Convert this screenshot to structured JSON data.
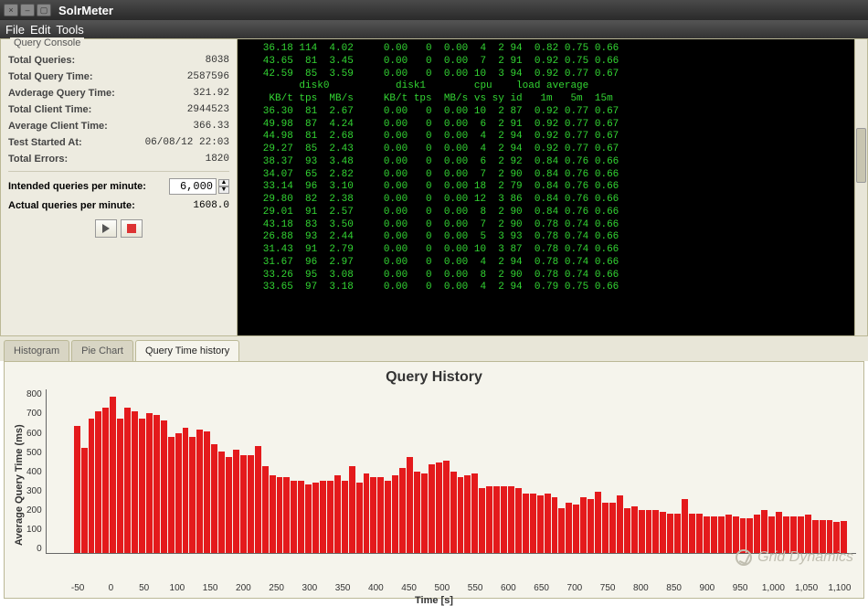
{
  "window": {
    "title": "SolrMeter"
  },
  "menu": {
    "file": "File",
    "edit": "Edit",
    "tools": "Tools"
  },
  "panel": {
    "legend": "Query Console",
    "stats": [
      {
        "label": "Total Queries:",
        "value": "8038"
      },
      {
        "label": "Total Query Time:",
        "value": "2587596"
      },
      {
        "label": "Avderage Query Time:",
        "value": "321.92"
      },
      {
        "label": "Total Client Time:",
        "value": "2944523"
      },
      {
        "label": "Average Client Time:",
        "value": "366.33"
      },
      {
        "label": "Test Started At:",
        "value": "06/08/12 22:03"
      },
      {
        "label": "Total Errors:",
        "value": "1820"
      }
    ],
    "intended_label": "Intended queries per minute:",
    "intended_value": "6,000",
    "actual_label": "Actual queries per minute:",
    "actual_value": "1608.0"
  },
  "tabs": {
    "histogram": "Histogram",
    "pie": "Pie Chart",
    "history": "Query Time history"
  },
  "terminal": {
    "header": "         disk0           disk1        cpu    load average",
    "cols": "    KB/t tps  MB/s     KB/t tps  MB/s vs sy id   1m   5m  15m",
    "rows": [
      "   36.18 114  4.02     0.00   0  0.00  4  2 94  0.82 0.75 0.66",
      "   43.65  81  3.45     0.00   0  0.00  7  2 91  0.92 0.75 0.66",
      "   42.59  85  3.59     0.00   0  0.00 10  3 94  0.92 0.77 0.67",
      "   36.30  81  2.67     0.00   0  0.00 10  2 87  0.92 0.77 0.67",
      "   49.98  87  4.24     0.00   0  0.00  6  2 91  0.92 0.77 0.67",
      "   44.98  81  2.68     0.00   0  0.00  4  2 94  0.92 0.77 0.67",
      "   29.27  85  2.43     0.00   0  0.00  4  2 94  0.92 0.77 0.67",
      "   38.37  93  3.48     0.00   0  0.00  6  2 92  0.84 0.76 0.66",
      "   34.07  65  2.82     0.00   0  0.00  7  2 90  0.84 0.76 0.66",
      "   33.14  96  3.10     0.00   0  0.00 18  2 79  0.84 0.76 0.66",
      "   29.80  82  2.38     0.00   0  0.00 12  3 86  0.84 0.76 0.66",
      "   29.01  91  2.57     0.00   0  0.00  8  2 90  0.84 0.76 0.66",
      "   43.18  83  3.50     0.00   0  0.00  7  2 90  0.78 0.74 0.66",
      "   26.88  93  2.44     0.00   0  0.00  5  3 93  0.78 0.74 0.66",
      "   31.43  91  2.79     0.00   0  0.00 10  3 87  0.78 0.74 0.66",
      "   31.67  96  2.97     0.00   0  0.00  4  2 94  0.78 0.74 0.66",
      "   33.26  95  3.08     0.00   0  0.00  8  2 90  0.78 0.74 0.66",
      "   33.65  97  3.18     0.00   0  0.00  4  2 94  0.79 0.75 0.66"
    ]
  },
  "chart_data": {
    "type": "bar",
    "title": "Query History",
    "xlabel": "Time [s]",
    "ylabel": "Average Query Time (ms)",
    "ylim": [
      0,
      900
    ],
    "xlim": [
      -50,
      1100
    ],
    "x_ticks": [
      "-50",
      "0",
      "50",
      "100",
      "150",
      "200",
      "250",
      "300",
      "350",
      "400",
      "450",
      "500",
      "550",
      "600",
      "650",
      "700",
      "750",
      "800",
      "850",
      "900",
      "950",
      "1,000",
      "1,050",
      "1,100"
    ],
    "y_ticks": [
      "0",
      "100",
      "200",
      "300",
      "400",
      "500",
      "600",
      "700",
      "800"
    ],
    "categories_step": 10,
    "values": [
      700,
      580,
      740,
      780,
      800,
      860,
      740,
      800,
      780,
      740,
      770,
      760,
      730,
      640,
      660,
      690,
      640,
      680,
      670,
      600,
      560,
      530,
      570,
      540,
      540,
      590,
      480,
      430,
      420,
      420,
      400,
      400,
      380,
      390,
      400,
      400,
      430,
      400,
      480,
      390,
      440,
      420,
      420,
      400,
      430,
      470,
      530,
      450,
      440,
      490,
      500,
      510,
      450,
      420,
      430,
      440,
      360,
      370,
      370,
      370,
      370,
      360,
      330,
      330,
      320,
      330,
      310,
      250,
      280,
      270,
      310,
      300,
      340,
      280,
      280,
      320,
      250,
      260,
      240,
      240,
      240,
      230,
      220,
      220,
      300,
      220,
      220,
      200,
      200,
      200,
      210,
      200,
      190,
      190,
      210,
      240,
      200,
      230,
      200,
      200,
      200,
      210,
      180,
      180,
      180,
      170,
      175
    ]
  },
  "footer": {
    "brand": "Grid Dynamics"
  }
}
